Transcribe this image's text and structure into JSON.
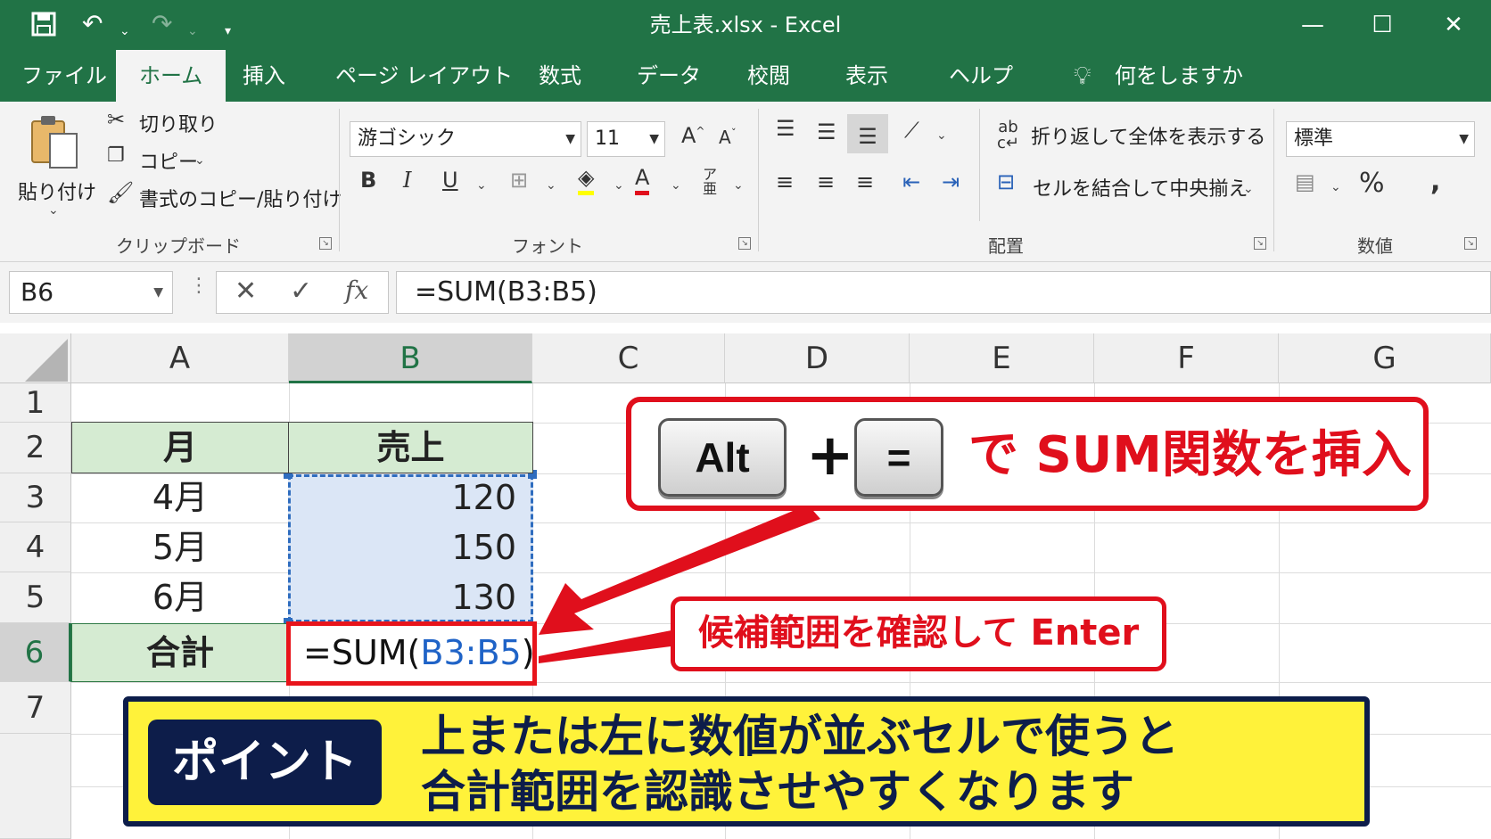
{
  "window": {
    "title": "売上表.xlsx  -  Excel"
  },
  "ribbon_tabs": [
    {
      "label": "ファイル"
    },
    {
      "label": "ホーム"
    },
    {
      "label": "挿入"
    },
    {
      "label": "ページ レイアウト"
    },
    {
      "label": "数式"
    },
    {
      "label": "データ"
    },
    {
      "label": "校閲"
    },
    {
      "label": "表示"
    },
    {
      "label": "ヘルプ"
    }
  ],
  "tell_me": "何をしますか",
  "clipboard": {
    "paste": "貼り付け",
    "cut": "切り取り",
    "copy": "コピー",
    "format_painter": "書式のコピー/貼り付け",
    "label": "クリップボード"
  },
  "font": {
    "name": "游ゴシック",
    "size": "11",
    "bold": "B",
    "italic": "I",
    "underline": "U",
    "font_color_glyph": "A",
    "label": "フォント"
  },
  "alignment": {
    "wrap": "折り返して全体を表示する",
    "merge": "セルを結合して中央揃え",
    "label": "配置"
  },
  "number": {
    "format": "標準",
    "percent": "%",
    "comma": ",",
    "label": "数値"
  },
  "formula_bar": {
    "name_box": "B6",
    "fx": "fx",
    "formula": "=SUM(B3:B5)"
  },
  "sheet": {
    "columns": [
      "A",
      "B",
      "C",
      "D",
      "E",
      "F",
      "G"
    ],
    "rows": [
      "1",
      "2",
      "3",
      "4",
      "5",
      "6",
      "7"
    ],
    "header_month": "月",
    "header_sales": "売上",
    "months": [
      "4月",
      "5月",
      "6月"
    ],
    "values": [
      "120",
      "150",
      "130"
    ],
    "total_label": "合計",
    "edit_prefix": "=SUM(",
    "edit_ref": "B3:B5",
    "edit_suffix": ")"
  },
  "annotations": {
    "key_alt": "Alt",
    "key_plus": "+",
    "key_equals": "=",
    "main": "で  SUM関数を挿入",
    "enter": "候補範囲を確認して Enter",
    "point_label": "ポイント",
    "point_line1": "上または左に数値が並ぶセルで使うと",
    "point_line2": "合計範囲を認識させやすくなります"
  },
  "colors": {
    "excel_green": "#217346",
    "annotation_red": "#e00f1c",
    "point_yellow": "#fff23a",
    "point_navy": "#0d1d4a",
    "header_fill": "#d5ebd2",
    "ref_blue": "#1f63c7"
  }
}
